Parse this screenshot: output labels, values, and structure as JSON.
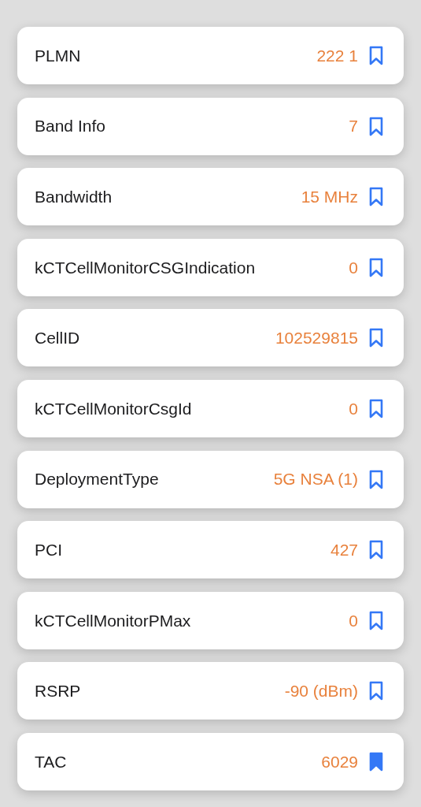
{
  "rows": [
    {
      "label": "PLMN",
      "value": "222 1",
      "bookmarked": false
    },
    {
      "label": "Band Info",
      "value": "7",
      "bookmarked": false
    },
    {
      "label": "Bandwidth",
      "value": "15 MHz",
      "bookmarked": false
    },
    {
      "label": "kCTCellMonitorCSGIndication",
      "value": "0",
      "bookmarked": false
    },
    {
      "label": "CellID",
      "value": "102529815",
      "bookmarked": false
    },
    {
      "label": "kCTCellMonitorCsgId",
      "value": "0",
      "bookmarked": false
    },
    {
      "label": "DeploymentType",
      "value": "5G NSA (1)",
      "bookmarked": false
    },
    {
      "label": "PCI",
      "value": "427",
      "bookmarked": false
    },
    {
      "label": "kCTCellMonitorPMax",
      "value": "0",
      "bookmarked": false
    },
    {
      "label": "RSRP",
      "value": "-90 (dBm)",
      "bookmarked": false
    },
    {
      "label": "TAC",
      "value": "6029",
      "bookmarked": true
    }
  ]
}
